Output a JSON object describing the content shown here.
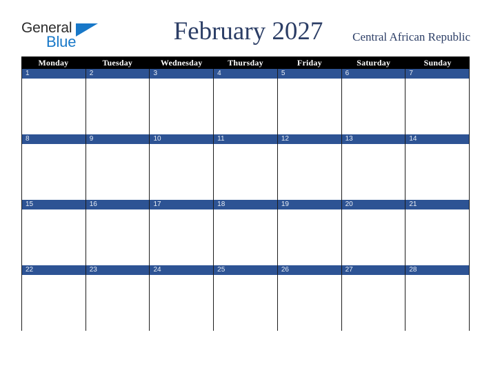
{
  "brand": {
    "line1": "General",
    "line2": "Blue",
    "triangle_icon": "triangle-right-icon",
    "line1_color": "#2b2b2b",
    "line2_color": "#1878c8"
  },
  "header": {
    "title": "February 2027",
    "subtitle": "Central African Republic",
    "title_color": "#2c3e66"
  },
  "calendar": {
    "weekday_header_bg": "#000000",
    "weekday_header_color": "#ffffff",
    "date_bar_bg": "#2d5394",
    "date_bar_color": "#e9eef6",
    "grid_border_color": "#1a1a1a",
    "weekdays": [
      "Monday",
      "Tuesday",
      "Wednesday",
      "Thursday",
      "Friday",
      "Saturday",
      "Sunday"
    ],
    "weeks": [
      [
        "1",
        "2",
        "3",
        "4",
        "5",
        "6",
        "7"
      ],
      [
        "8",
        "9",
        "10",
        "11",
        "12",
        "13",
        "14"
      ],
      [
        "15",
        "16",
        "17",
        "18",
        "19",
        "20",
        "21"
      ],
      [
        "22",
        "23",
        "24",
        "25",
        "26",
        "27",
        "28"
      ]
    ]
  }
}
